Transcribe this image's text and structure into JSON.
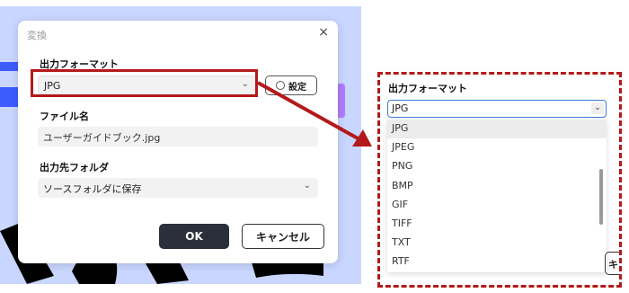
{
  "dialog": {
    "title": "変換",
    "close_glyph": "×",
    "format_label": "出力フォーマット",
    "format_value": "JPG",
    "settings_label": "設定",
    "filename_label": "ファイル名",
    "filename_value": "ユーザーガイドブック.jpg",
    "output_folder_label": "出力先フォルダ",
    "output_folder_value": "ソースフォルダに保存",
    "ok_label": "OK",
    "cancel_label": "キャンセル"
  },
  "icons": [
    "close-icon",
    "chevron-down-icon",
    "gear-icon"
  ],
  "zoom": {
    "label": "出力フォーマット",
    "selected_value": "JPG",
    "options": [
      "JPG",
      "JPEG",
      "PNG",
      "BMP",
      "GIF",
      "TIFF",
      "TXT",
      "RTF"
    ],
    "behind_button_fragment": "キ"
  },
  "colors": {
    "highlight": "#b3191b",
    "background_app": "#c9d6ff",
    "ok_button": "#2a2f3a",
    "focus_border": "#3b7bd8"
  }
}
